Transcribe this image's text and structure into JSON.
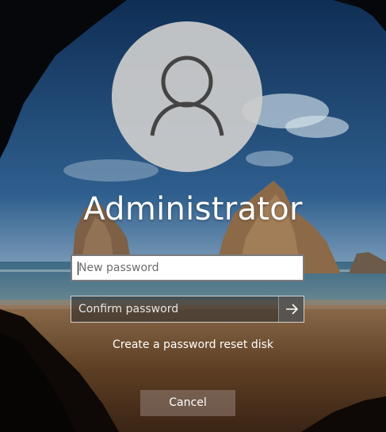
{
  "user": {
    "name": "Administrator",
    "avatar_icon": "user-icon"
  },
  "new_password": {
    "placeholder": "New password",
    "value": ""
  },
  "confirm_password": {
    "placeholder": "Confirm password",
    "value": "",
    "submit_icon": "arrow-right-icon"
  },
  "links": {
    "reset_disk": "Create a password reset disk"
  },
  "buttons": {
    "cancel": "Cancel"
  },
  "colors": {
    "sky": "#1c3d63",
    "sand": "#6e4a2a",
    "cave": "#0b0f14",
    "accent_text": "#ffffff"
  }
}
